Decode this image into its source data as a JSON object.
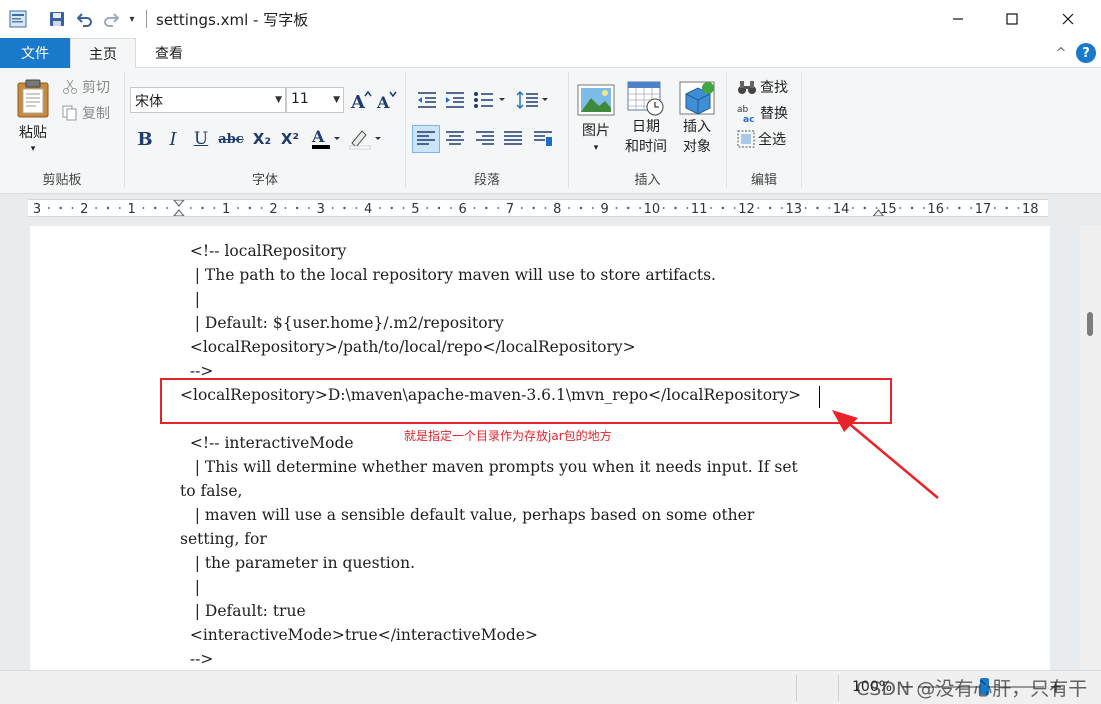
{
  "window": {
    "title": "settings.xml - 写字板",
    "quick_access": [
      "app-icon",
      "save-icon",
      "undo-icon",
      "redo-icon",
      "customize-dropdown"
    ],
    "controls": [
      "minimize-icon",
      "maximize-icon",
      "close-icon"
    ]
  },
  "tabs": [
    {
      "label": "文件",
      "active": false
    },
    {
      "label": "主页",
      "active": true
    },
    {
      "label": "查看",
      "active": false
    }
  ],
  "ribbon": {
    "clipboard": {
      "group_label": "剪贴板",
      "paste_label": "粘贴",
      "cut_label": "剪切",
      "copy_label": "复制"
    },
    "font": {
      "group_label": "字体",
      "font_name": "宋体",
      "font_size": "11",
      "buttons": [
        "B",
        "I",
        "U",
        "abc",
        "X₂",
        "X²",
        "A",
        "✎"
      ],
      "font_color": "#000000"
    },
    "paragraph": {
      "group_label": "段落"
    },
    "insert": {
      "group_label": "插入",
      "picture_label": "图片",
      "datetime_label_1": "日期",
      "datetime_label_2": "和时间",
      "object_label_1": "插入",
      "object_label_2": "对象"
    },
    "edit": {
      "group_label": "编辑",
      "find_label": "查找",
      "replace_label": "替换",
      "select_all_label": "全选"
    }
  },
  "ruler": {
    "labels": [
      "3",
      "2",
      "1",
      "",
      "1",
      "2",
      "3",
      "4",
      "5",
      "6",
      "7",
      "8",
      "9",
      "10",
      "11",
      "12",
      "13",
      "14",
      "15",
      "16",
      "17",
      "18"
    ]
  },
  "document": {
    "lines": [
      "  <!-- localRepository",
      "   | The path to the local repository maven will use to store artifacts.",
      "   |",
      "   | Default: ${user.home}/.m2/repository",
      "  <localRepository>/path/to/local/repo</localRepository>",
      "  -->",
      "<localRepository>D:\\maven\\apache-maven-3.6.1\\mvn_repo</localRepository>",
      "",
      "  <!-- interactiveMode",
      "   | This will determine whether maven prompts you when it needs input. If set",
      "to false,",
      "   | maven will use a sensible default value, perhaps based on some other",
      "setting, for",
      "   | the parameter in question.",
      "   |",
      "   | Default: true",
      "  <interactiveMode>true</interactiveMode>",
      "  -->"
    ],
    "annotation": "就是指定一个目录作为存放jar包的地方",
    "annotation_color": "#e8232a"
  },
  "status": {
    "zoom": "100%",
    "watermark": "CSDN @没有心肝，只有干"
  },
  "colors": {
    "accent": "#1979ca",
    "highlight": "#e8232a"
  }
}
